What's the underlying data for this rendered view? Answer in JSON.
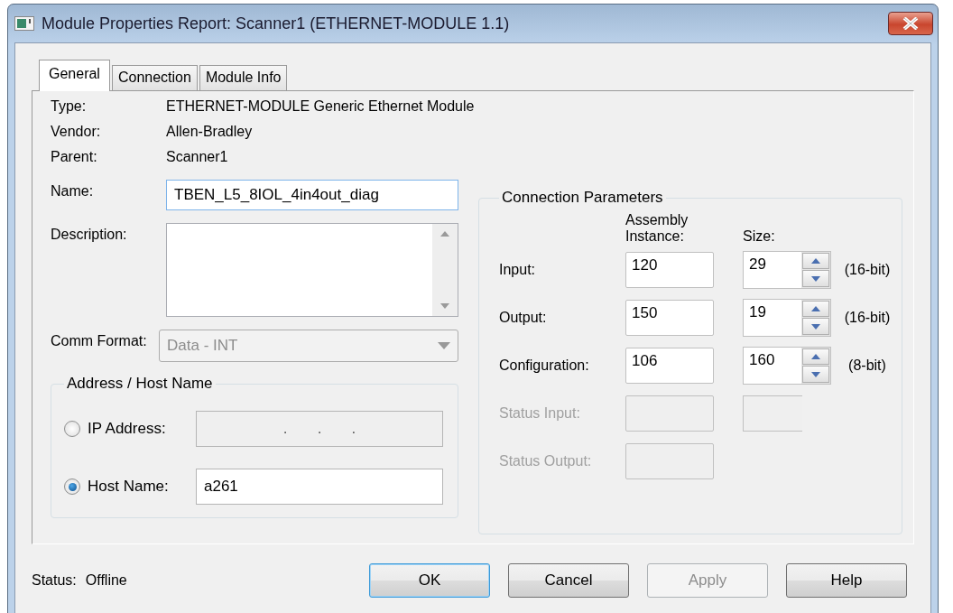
{
  "window": {
    "title": "Module Properties Report: Scanner1 (ETHERNET-MODULE 1.1)"
  },
  "tabs": [
    {
      "label": "General",
      "selected": true
    },
    {
      "label": "Connection",
      "selected": false
    },
    {
      "label": "Module Info",
      "selected": false
    }
  ],
  "info": [
    {
      "label": "Type:",
      "value": "ETHERNET-MODULE Generic Ethernet Module"
    },
    {
      "label": "Vendor:",
      "value": "Allen-Bradley"
    },
    {
      "label": "Parent:",
      "value": "Scanner1"
    }
  ],
  "name": {
    "label": "Name:",
    "value": "TBEN_L5_8IOL_4in4out_diag"
  },
  "description": {
    "label": "Description:"
  },
  "comm_format": {
    "label": "Comm Format:",
    "value": "Data - INT",
    "disabled": true
  },
  "address": {
    "title": "Address / Host Name",
    "options": [
      {
        "label": "IP Address:",
        "selected": false,
        "kind": "ip",
        "value": ".       .       ."
      },
      {
        "label": "Host Name:",
        "selected": true,
        "kind": "text",
        "value": "a261"
      }
    ]
  },
  "connection_parameters": {
    "title": "Connection Parameters",
    "headers": [
      "Assembly\nInstance:",
      "Size:"
    ],
    "rows": [
      {
        "label": "Input:",
        "kind": "spin",
        "disabled": false,
        "instance": "120",
        "size": "29",
        "unit": "(16-bit)"
      },
      {
        "label": "Output:",
        "kind": "spin",
        "disabled": false,
        "instance": "150",
        "size": "19",
        "unit": "(16-bit)"
      },
      {
        "label": "Configuration:",
        "kind": "spin",
        "disabled": false,
        "instance": "106",
        "size": "160",
        "unit": "(8-bit)"
      },
      {
        "label": "Status Input:",
        "kind": "pair",
        "disabled": true
      },
      {
        "label": "Status Output:",
        "kind": "single",
        "disabled": true
      }
    ]
  },
  "status": {
    "label": "Status:",
    "value": "Offline"
  },
  "buttons": [
    {
      "label": "OK",
      "default": true,
      "disabled": false
    },
    {
      "label": "Cancel",
      "default": false,
      "disabled": false
    },
    {
      "label": "Apply",
      "default": false,
      "disabled": true
    },
    {
      "label": "Help",
      "default": false,
      "disabled": false
    }
  ]
}
